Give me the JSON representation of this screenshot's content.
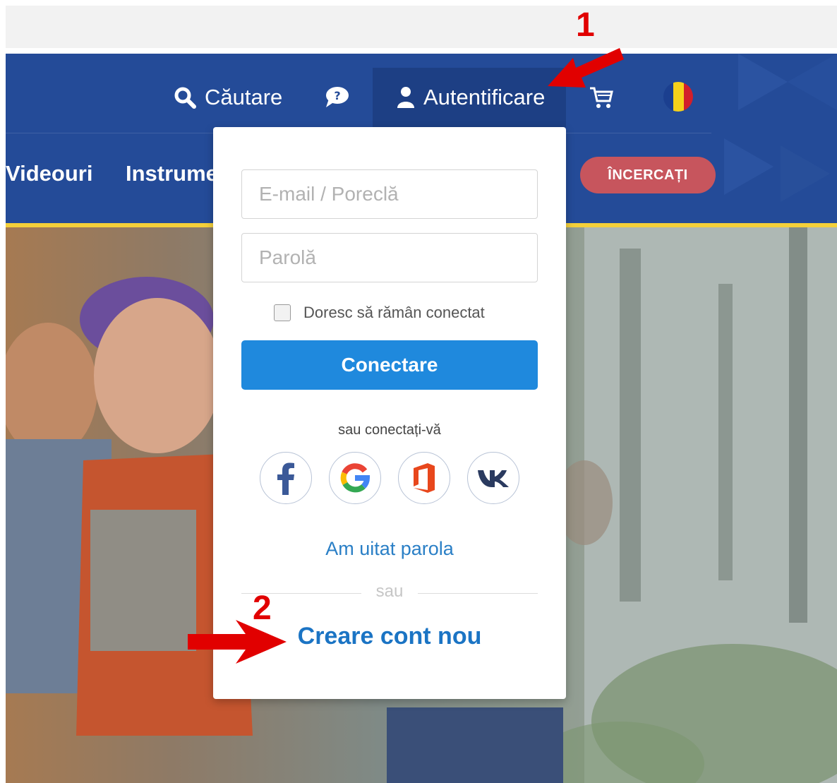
{
  "header": {
    "search_label": "Căutare",
    "login_label": "Autentificare",
    "menu_videos": "Videouri",
    "menu_tools": "Instrumente",
    "try_label": "ÎNCERCAȚI"
  },
  "icons": {
    "search": "search-icon",
    "help": "help-chat-icon",
    "user": "user-icon",
    "cart": "cart-icon",
    "flag": "romania-flag-icon",
    "facebook": "facebook-icon",
    "google": "google-icon",
    "office": "office-icon",
    "vk": "vk-icon"
  },
  "login_form": {
    "email_placeholder": "E-mail / Poreclă",
    "password_placeholder": "Parolă",
    "remember_label": "Doresc să rămân conectat",
    "remember_checked": false,
    "connect_button": "Conectare",
    "social_caption": "sau conectați-vă",
    "forgot_password": "Am uitat parola",
    "or_separator": "sau",
    "create_account": "Creare cont nou"
  },
  "annotations": {
    "step1": "1",
    "step2": "2"
  },
  "colors": {
    "header_bg": "#244b98",
    "accent_yellow": "#f4d03a",
    "connect_button": "#1f89dd",
    "try_button": "#c7555d",
    "link_blue": "#1b74c4",
    "annotation_red": "#e10000"
  }
}
